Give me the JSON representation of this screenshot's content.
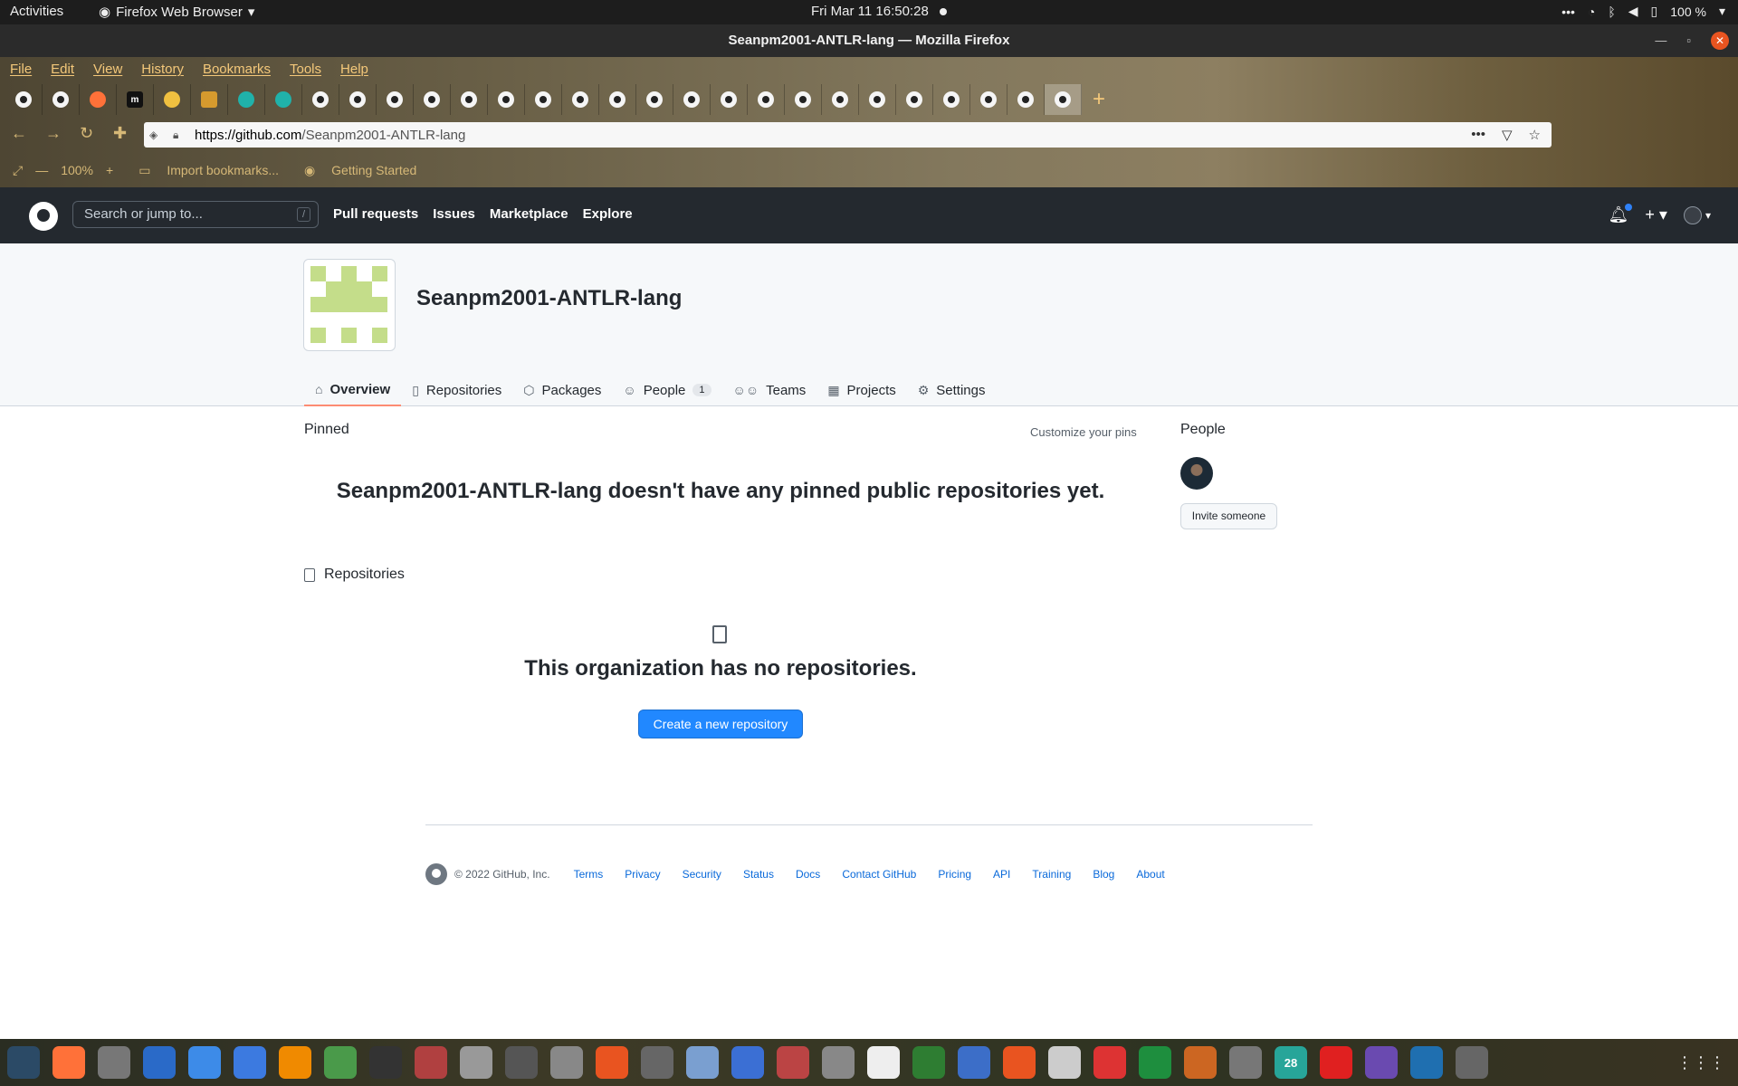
{
  "system_bar": {
    "activities": "Activities",
    "app_name": "Firefox Web Browser",
    "clock": "Fri Mar 11  16:50:28",
    "battery": "100 %"
  },
  "window": {
    "title": "Seanpm2001-ANTLR-lang — Mozilla Firefox",
    "menu": [
      "File",
      "Edit",
      "View",
      "History",
      "Bookmarks",
      "Tools",
      "Help"
    ]
  },
  "tabs": {
    "icons": [
      "github-icon",
      "github-icon",
      "firefox-icon",
      "m-icon",
      "gear-icon",
      "puzzle-icon",
      "cog-icon",
      "cog-icon",
      "github-icon",
      "github-icon",
      "github-icon",
      "github-icon",
      "github-icon",
      "github-icon",
      "github-icon",
      "github-icon",
      "github-icon",
      "github-icon",
      "github-icon",
      "github-icon",
      "github-icon",
      "github-icon",
      "github-icon",
      "github-icon",
      "github-icon",
      "github-icon",
      "github-icon",
      "github-icon",
      "github-icon"
    ],
    "m_label": "m"
  },
  "urlbar": {
    "host": "https://github.com",
    "path": "/Seanpm2001-ANTLR-lang",
    "zoom": "100%"
  },
  "bookmarks": {
    "import": "Import bookmarks...",
    "getting_started": "Getting Started"
  },
  "github": {
    "search_placeholder": "Search or jump to...",
    "search_key": "/",
    "nav": [
      "Pull requests",
      "Issues",
      "Marketplace",
      "Explore"
    ],
    "org_name": "Seanpm2001-ANTLR-lang",
    "org_tabs": [
      {
        "label": "Overview",
        "icon": "home-icon"
      },
      {
        "label": "Repositories",
        "icon": "repo-icon"
      },
      {
        "label": "Packages",
        "icon": "package-icon"
      },
      {
        "label": "People",
        "icon": "person-icon",
        "count": "1"
      },
      {
        "label": "Teams",
        "icon": "people-icon"
      },
      {
        "label": "Projects",
        "icon": "table-icon"
      },
      {
        "label": "Settings",
        "icon": "gear-icon"
      }
    ],
    "pinned_label": "Pinned",
    "customize_pins": "Customize your pins",
    "no_pinned": "Seanpm2001-ANTLR-lang doesn't have any pinned public repositories yet.",
    "repositories_label": "Repositories",
    "no_repos": "This organization has no repositories.",
    "create_repo": "Create a new repository",
    "people_title": "People",
    "invite": "Invite someone"
  },
  "footer": {
    "copyright": "© 2022 GitHub, Inc.",
    "links": [
      "Terms",
      "Privacy",
      "Security",
      "Status",
      "Docs",
      "Contact GitHub",
      "Pricing",
      "API",
      "Training",
      "Blog",
      "About"
    ]
  },
  "dock": {
    "calendar_day": "28"
  }
}
